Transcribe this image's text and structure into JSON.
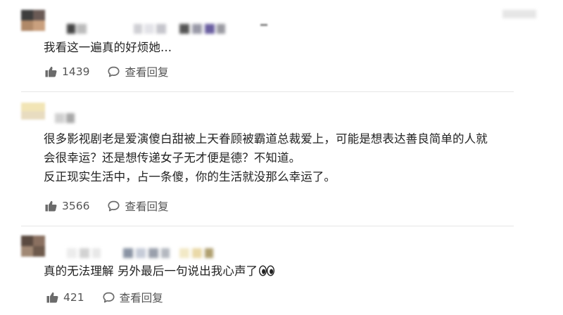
{
  "comments": [
    {
      "text_lines": [
        "我看这一遍真的好烦她..."
      ],
      "likes": "1439",
      "reply_label": "查看回复"
    },
    {
      "text_lines": [
        "很多影视剧老是爱演傻白甜被上天眷顾被霸道总裁爱上，可能是想表达善良简单的人就",
        "会很幸运？还是想传递女子无才便是德？不知道。",
        "反正现实生活中，占一条傻，你的生活就没那么幸运了。"
      ],
      "likes": "3566",
      "reply_label": "查看回复"
    },
    {
      "text_lines": [
        "真的无法理解 另外最后一句说出我心声了"
      ],
      "emoji": "eyes-emoji",
      "likes": "421",
      "reply_label": "查看回复"
    }
  ],
  "icons": {
    "like": "thumbs-up-icon",
    "reply": "chat-bubble-icon"
  },
  "colors": {
    "text": "#222222",
    "meta": "#555555",
    "icon": "#6b6b6b",
    "divider": "#e6e6e6"
  }
}
